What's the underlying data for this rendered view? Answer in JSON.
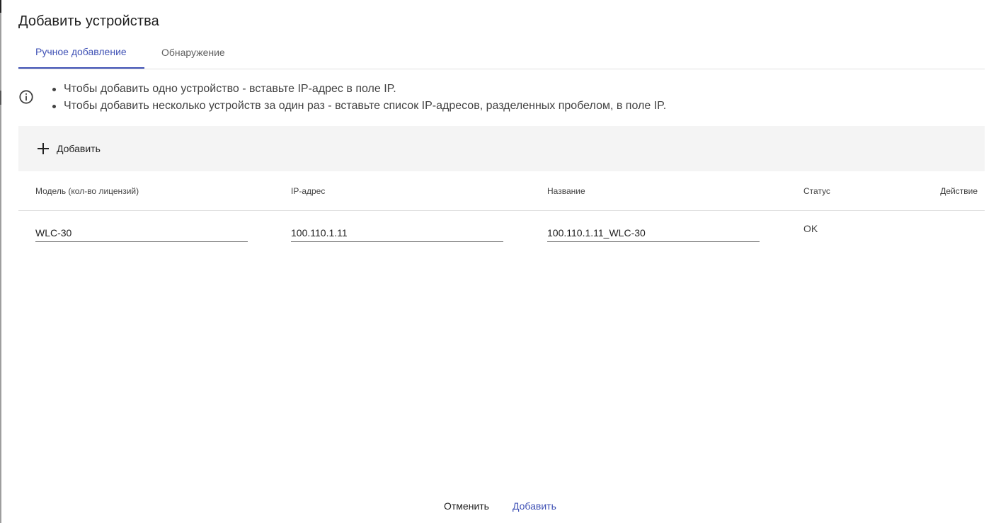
{
  "dialog": {
    "title": "Добавить устройства"
  },
  "tabs": [
    {
      "label": "Ручное добавление",
      "active": true
    },
    {
      "label": "Обнаружение",
      "active": false
    }
  ],
  "info": {
    "icon": "info-icon",
    "lines": [
      "Чтобы добавить одно устройство - вставьте IP-адрес в поле IP.",
      "Чтобы добавить несколько устройств за один раз - вставьте список IP-адресов, разделенных пробелом, в поле IP."
    ]
  },
  "toolbar": {
    "add_label": "Добавить",
    "add_icon": "plus-icon"
  },
  "table": {
    "columns": {
      "model": "Модель (кол-во лицензий)",
      "ip": "IP-адрес",
      "name": "Название",
      "status": "Статус",
      "action": "Действие"
    },
    "rows": [
      {
        "model": "WLC-30",
        "ip": "100.110.1.11",
        "name": "100.110.1.11_WLC-30",
        "status": "OK"
      }
    ]
  },
  "footer": {
    "cancel_label": "Отменить",
    "confirm_label": "Добавить"
  },
  "colors": {
    "accent": "#3f51b5",
    "toolbar_bg": "#f4f4f4",
    "divider": "#e0e0e0"
  }
}
